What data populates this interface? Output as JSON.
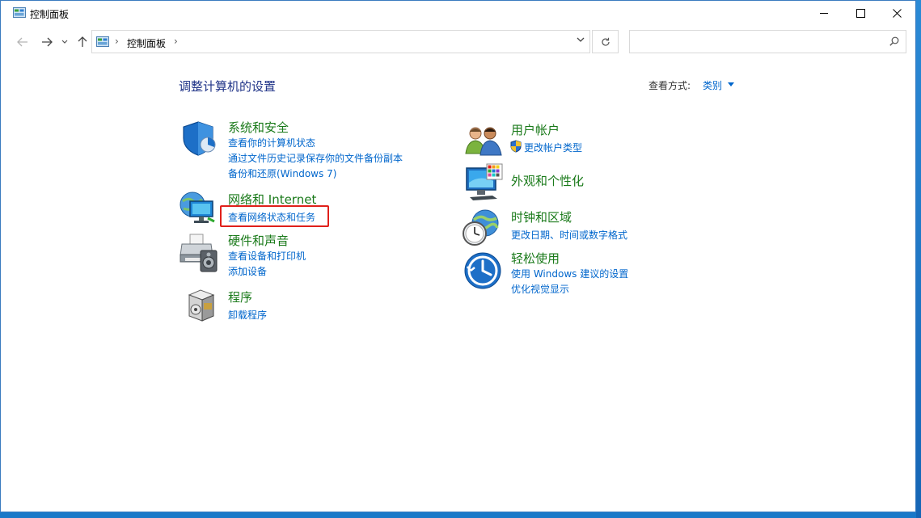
{
  "window": {
    "title": "控制面板"
  },
  "address": {
    "crumb": "控制面板",
    "separator": "›"
  },
  "search": {
    "placeholder": ""
  },
  "main": {
    "title": "调整计算机的设置",
    "view_by_label": "查看方式:",
    "view_by_value": "类别"
  },
  "categories": {
    "system": {
      "title": "系统和安全",
      "links": [
        "查看你的计算机状态",
        "通过文件历史记录保存你的文件备份副本",
        "备份和还原(Windows 7)"
      ]
    },
    "network": {
      "title": "网络和 Internet",
      "links": [
        "查看网络状态和任务"
      ]
    },
    "hardware": {
      "title": "硬件和声音",
      "links": [
        "查看设备和打印机",
        "添加设备"
      ]
    },
    "programs": {
      "title": "程序",
      "links": [
        "卸载程序"
      ]
    },
    "users": {
      "title": "用户帐户",
      "links": [
        "更改帐户类型"
      ]
    },
    "appearance": {
      "title": "外观和个性化",
      "links": []
    },
    "clock": {
      "title": "时钟和区域",
      "links": [
        "更改日期、时间或数字格式"
      ]
    },
    "ease": {
      "title": "轻松使用",
      "links": [
        "使用 Windows 建议的设置",
        "优化视觉显示"
      ]
    }
  },
  "colors": {
    "category_title": "#1a7a1a",
    "link": "#0066cc",
    "page_title": "#1e3287",
    "highlight": "#e0201a"
  }
}
